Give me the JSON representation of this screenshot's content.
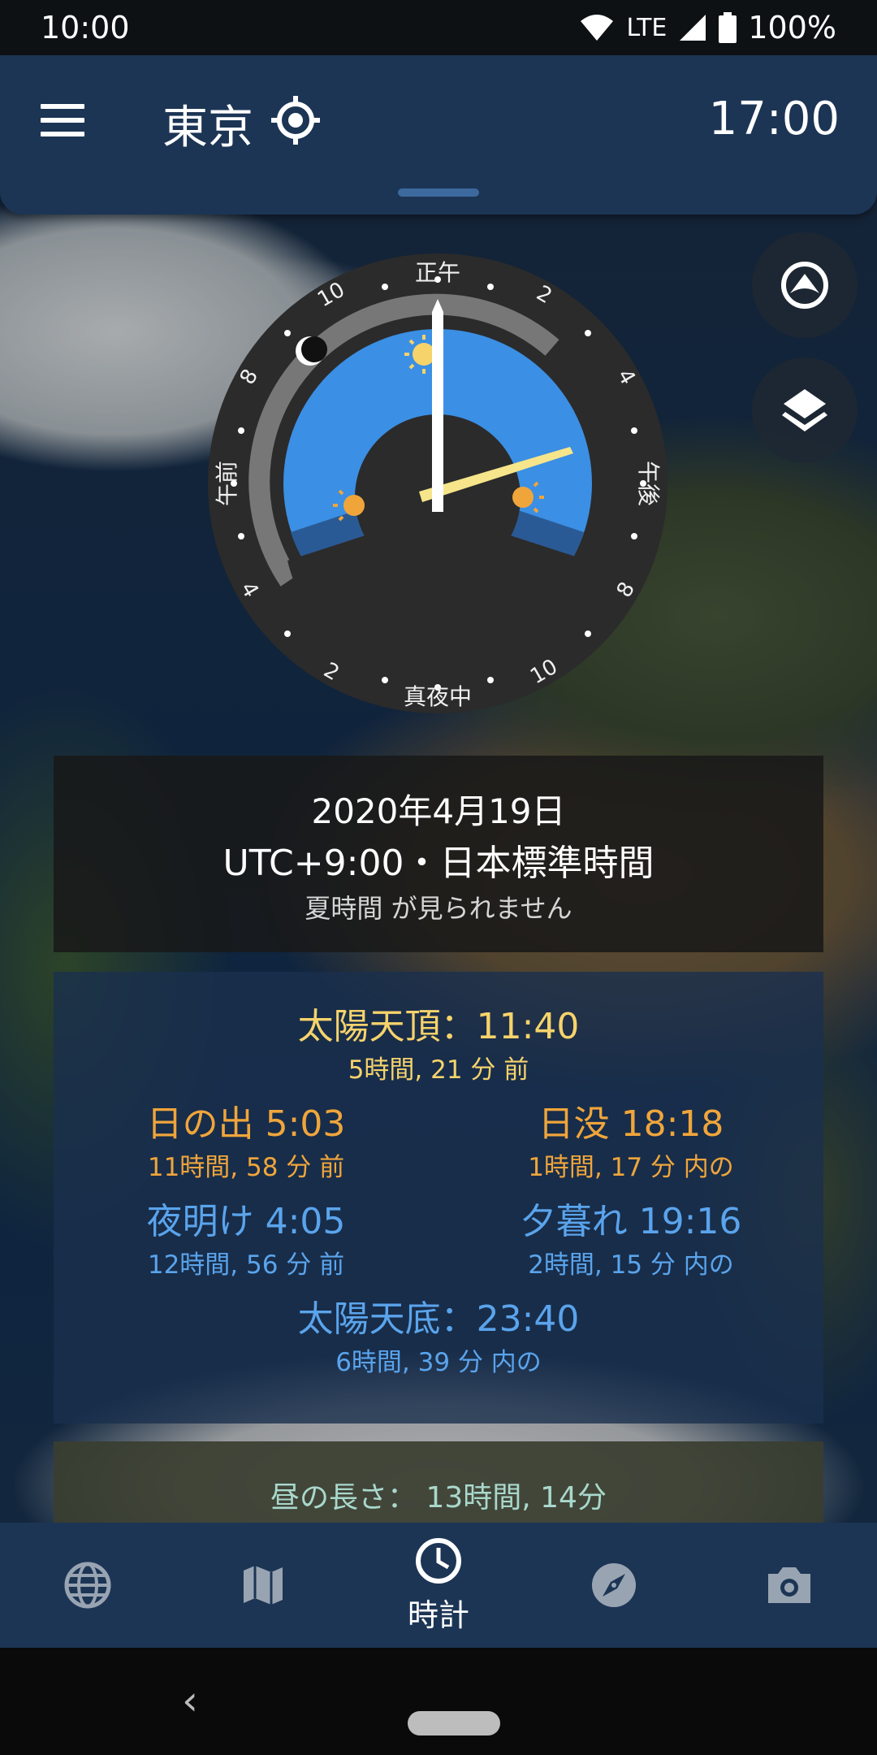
{
  "status_bar": {
    "time": "10:00",
    "network": "LTE",
    "battery": "100%"
  },
  "header": {
    "city": "東京",
    "time": "17:00"
  },
  "clock": {
    "labels": {
      "top": "正午",
      "bottom": "真夜中",
      "left": "午前",
      "right": "午後"
    },
    "numbers": [
      "10",
      "2",
      "4",
      "8",
      "8",
      "4",
      "2",
      "10"
    ]
  },
  "date_card": {
    "date": "2020年4月19日",
    "timezone": "UTC+9:00・日本標準時間",
    "dst": "夏時間 が見られません"
  },
  "sun_card": {
    "zenith": {
      "label": "太陽天頂：11:40",
      "relative": "5時間, 21 分 前"
    },
    "sunrise": {
      "label": "日の出 5:03",
      "relative": "11時間, 58 分 前"
    },
    "sunset": {
      "label": "日没 18:18",
      "relative": "1時間, 17 分 内の"
    },
    "dawn": {
      "label": "夜明け 4:05",
      "relative": "12時間, 56 分 前"
    },
    "dusk": {
      "label": "夕暮れ 19:16",
      "relative": "2時間, 15 分 内の"
    },
    "nadir": {
      "label": "太陽天底：23:40",
      "relative": "6時間, 39 分 内の"
    }
  },
  "day_card": {
    "day_length": "昼の長さ： 13時間, 14分"
  },
  "bottom_nav": {
    "items": [
      {
        "icon": "globe-icon",
        "label": ""
      },
      {
        "icon": "map-icon",
        "label": ""
      },
      {
        "icon": "clock-icon",
        "label": "時計"
      },
      {
        "icon": "compass-icon",
        "label": ""
      },
      {
        "icon": "camera-icon",
        "label": ""
      }
    ]
  },
  "colors": {
    "app_bar": "#1c3555",
    "day_sky": "#3b8fe4",
    "twilight": "#2a5a95",
    "sun_yellow": "#f6d36b",
    "orange": "#f0a53b",
    "blue_text": "#5aa4ec"
  }
}
